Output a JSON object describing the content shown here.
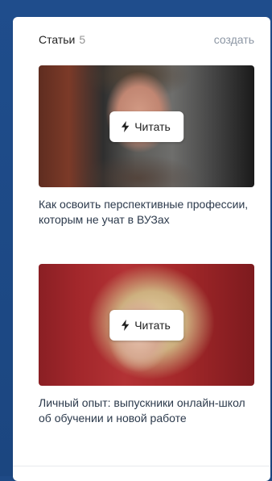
{
  "articles_block": {
    "title": "Статьи",
    "count": "5",
    "create_label": "создать",
    "read_label": "Читать",
    "items": [
      {
        "title": "Как освоить перспективные профессии, которым не учат в ВУЗах",
        "button_icon": "lightning-icon"
      },
      {
        "title": "Личный опыт: выпускники онлайн-школ об обучении и новой работе",
        "button_icon": "lightning-icon"
      }
    ]
  },
  "colors": {
    "page_background": "#1e4a86",
    "card_background": "#ffffff",
    "muted_text": "#939393",
    "link_text": "#8c96a4"
  }
}
